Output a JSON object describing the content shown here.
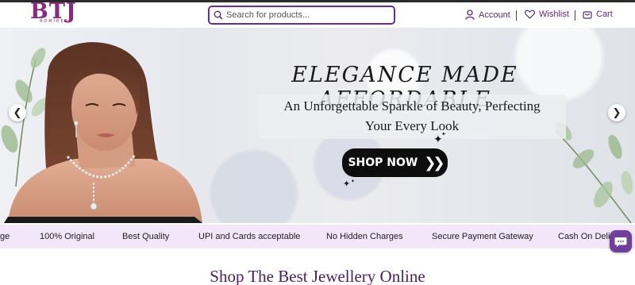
{
  "header": {
    "logo_text": "BTJ",
    "logo_subtext": "ADMIRER",
    "search_placeholder": "Search for products...",
    "nav": {
      "account": "Account",
      "wishlist": "Wishlist",
      "cart": "Cart"
    }
  },
  "banner": {
    "headline": "ELEGANCE MADE AFFORDABLE",
    "subline_1": "An Unforgettable Sparkle of Beauty, Perfecting",
    "subline_2": "Your Every Look",
    "cta_label": "SHOP NOW"
  },
  "features_strip": {
    "items": [
      "ge",
      "100% Original",
      "Best Quality",
      "UPI and Cards acceptable",
      "No Hidden Charges",
      "Secure Payment Gateway",
      "Cash On Deliv"
    ]
  },
  "section": {
    "title": "Shop The Best Jewellery Online"
  },
  "colors": {
    "brand_purple": "#6a2c91",
    "strip_bg": "#f3e6f8",
    "cta_bg": "#0e0e0e",
    "title_color": "#4a1f5e"
  },
  "icons": [
    "search-icon",
    "user-icon",
    "heart-icon",
    "cart-icon",
    "chevron-left-icon",
    "chevron-right-icon",
    "chat-icon",
    "sparkle-icon"
  ]
}
